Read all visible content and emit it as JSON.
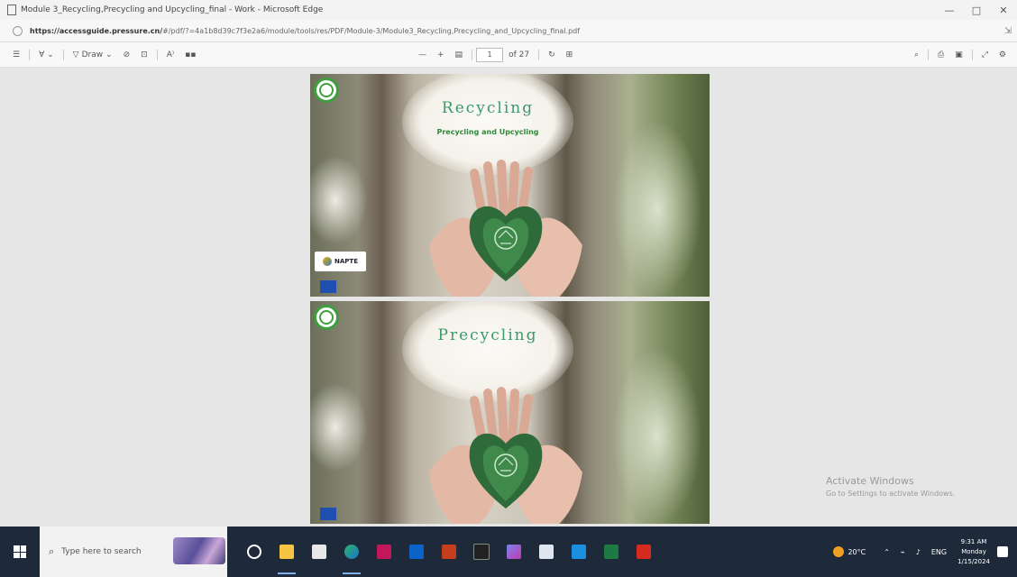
{
  "window": {
    "title": "Module 3_Recycling,Precycling and Upcycling_final - Work - Microsoft Edge",
    "minimize": "—",
    "maximize": "□",
    "close": "✕"
  },
  "address": {
    "url_domain": "https://accessguide.pressure.cn/",
    "url_path": "#/pdf/?=4a1b8d39c7f3e2a6/module/tools/res/PDF/Module-3/Module3_Recycling,Precycling_and_Upcycling_final.pdf"
  },
  "toolbar": {
    "draw_label": "Draw",
    "page_current": "1",
    "page_total": "of 27",
    "zoom_out": "—",
    "zoom_in": "+"
  },
  "slides": [
    {
      "title": "Recycling",
      "subtitle": "Precycling and Upcycling",
      "badge": "NAPTE"
    },
    {
      "title": "Precycling"
    }
  ],
  "watermark": {
    "line1": "Activate Windows",
    "line2": "Go to Settings to activate Windows."
  },
  "taskbar": {
    "search_placeholder": "Type here to search",
    "temperature": "20°C",
    "language": "ENG",
    "time": "9:31 AM",
    "day": "Monday",
    "date": "1/15/2024"
  },
  "colors": {
    "slide_title": "#3a9a6a",
    "taskbar_bg": "#1e2a3a",
    "accent": "#3f9e3f"
  }
}
